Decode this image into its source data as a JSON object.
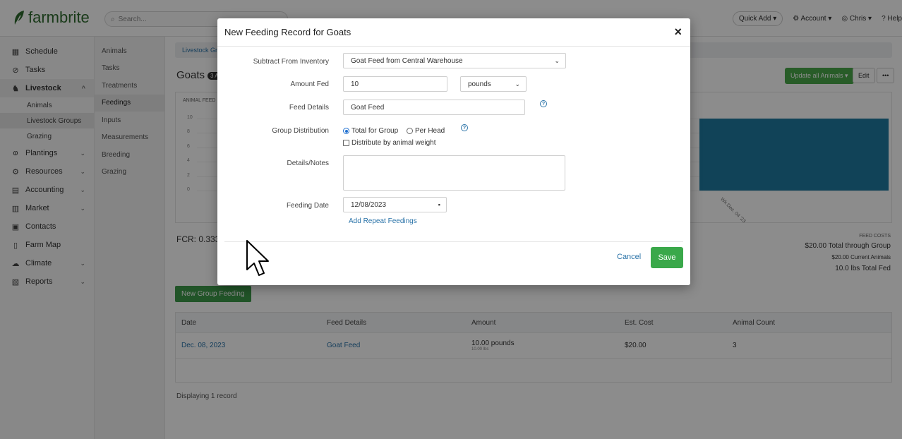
{
  "brand": {
    "name": "farmbrite"
  },
  "search": {
    "placeholder": "Search..."
  },
  "header": {
    "quick_add": "Quick Add",
    "account": "Account",
    "user": "Chris",
    "help": "Help"
  },
  "sidebar": {
    "items": [
      {
        "label": "Schedule"
      },
      {
        "label": "Tasks"
      },
      {
        "label": "Livestock"
      },
      {
        "label": "Plantings"
      },
      {
        "label": "Resources"
      },
      {
        "label": "Accounting"
      },
      {
        "label": "Market"
      },
      {
        "label": "Contacts"
      },
      {
        "label": "Farm Map"
      },
      {
        "label": "Climate"
      },
      {
        "label": "Reports"
      }
    ],
    "livestock_sub": [
      "Animals",
      "Livestock Groups",
      "Grazing"
    ]
  },
  "subnav": {
    "items": [
      "Animals",
      "Tasks",
      "Treatments",
      "Feedings",
      "Inputs",
      "Measurements",
      "Breeding",
      "Grazing"
    ]
  },
  "page": {
    "breadcrumb": "Livestock Gr",
    "title": "Goats",
    "badge": "3 A",
    "update_all": "Update all Animals",
    "edit": "Edit",
    "more": "•••"
  },
  "chart_data": {
    "type": "bar",
    "title": "ANIMAL FEED",
    "yticks": [
      "10",
      "8",
      "6",
      "4",
      "2",
      "0"
    ],
    "categories": [
      "Wk Dec. 04 '23"
    ],
    "values": [
      10
    ],
    "ylim": [
      0,
      10
    ]
  },
  "stats": {
    "fcr": "FCR: 0.333",
    "feed_costs_label": "FEED COSTS",
    "total_group": "$20.00 Total through Group",
    "current_animals": "$20.00 Current Animals",
    "total_fed": "10.0 lbs Total Fed"
  },
  "feedings": {
    "new_button": "New Group Feeding",
    "columns": [
      "Date",
      "Feed Details",
      "Amount",
      "Est. Cost",
      "Animal Count"
    ],
    "rows": [
      {
        "date": "Dec. 08, 2023",
        "feed": "Goat Feed",
        "amount": "10.00 pounds",
        "amount_sub": "10.00 lbs",
        "cost": "$20.00",
        "count": "3"
      }
    ],
    "displaying": "Displaying 1 record"
  },
  "modal": {
    "title": "New Feeding Record for Goats",
    "close": "×",
    "subtract_label": "Subtract From Inventory",
    "subtract_value": "Goat Feed from Central Warehouse",
    "amount_label": "Amount Fed",
    "amount_value": "10",
    "unit_value": "pounds",
    "feed_details_label": "Feed Details",
    "feed_details_value": "Goat Feed",
    "distribution_label": "Group Distribution",
    "option_total": "Total for Group",
    "option_per_head": "Per Head",
    "option_by_weight": "Distribute by animal weight",
    "notes_label": "Details/Notes",
    "date_label": "Feeding Date",
    "date_value": "12/08/2023",
    "add_repeat": "Add Repeat Feedings",
    "cancel": "Cancel",
    "save": "Save"
  }
}
